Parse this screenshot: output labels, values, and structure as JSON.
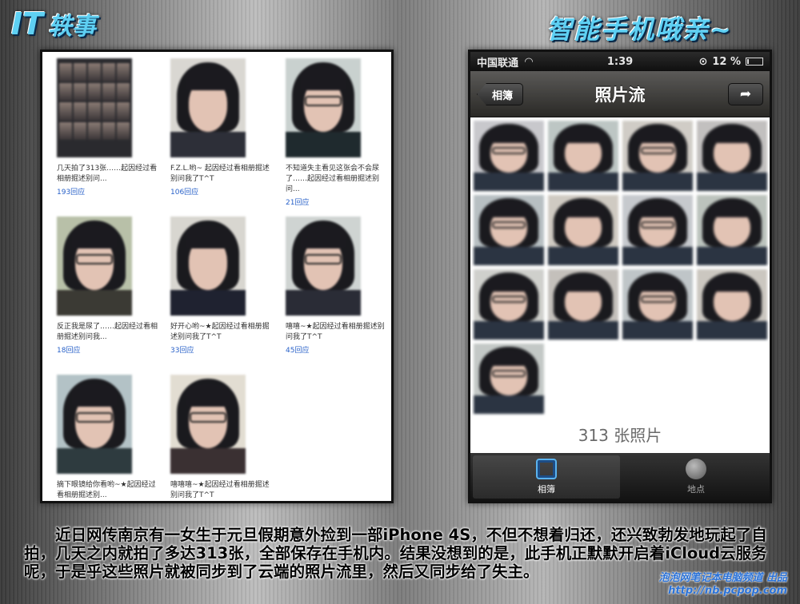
{
  "header": {
    "logo_it": "IT",
    "logo_cn": "轶事",
    "headline": "智能手机哦亲~"
  },
  "left_panel": {
    "items": [
      {
        "caption": "几天拍了313张……起因经过看相册掘述别问...",
        "replies": "193回应",
        "kind": "mosaic"
      },
      {
        "caption": "F.Z.L.哟~ 起因经过看相册掘述别问我了T^T",
        "replies": "106回应",
        "kind": "face"
      },
      {
        "caption": "不知道失主看见这张会不会尿了……起因经过看相册掘述别问...",
        "replies": "21回应",
        "kind": "face"
      },
      {
        "caption": "反正我是尿了……起因经过看相册掘述别问我...",
        "replies": "18回应",
        "kind": "face"
      },
      {
        "caption": "好开心哟~★起因经过看相册掘述别问我了T^T",
        "replies": "33回应",
        "kind": "face"
      },
      {
        "caption": "嘻嘻~★起因经过看相册掘述别问我了T^T",
        "replies": "45回应",
        "kind": "face"
      },
      {
        "caption": "摘下眼镜给你看哟~★起因经过看相册掘述别...",
        "replies": "",
        "kind": "face"
      },
      {
        "caption": "嘻嘻嘻~★起因经过看相册掘述别问我了T^T",
        "replies": "",
        "kind": "face"
      }
    ]
  },
  "phone": {
    "status": {
      "carrier": "中国联通",
      "time": "1:39",
      "battery": "12 %",
      "battery_level": 0.12
    },
    "nav": {
      "back_label": "相簿",
      "title": "照片流",
      "share_icon": "share-icon"
    },
    "thumb_count_visible": 13,
    "photo_count": "313 张照片",
    "tabs": [
      {
        "label": "相簿",
        "icon": "albums-icon",
        "active": true
      },
      {
        "label": "地点",
        "icon": "globe-icon",
        "active": false
      }
    ]
  },
  "footer": {
    "description": "近日网传南京有一女生于元旦假期意外捡到一部iPhone 4S，不但不想着归还，还兴致勃发地玩起了自拍，几天之内就拍了多达313张，全部保存在手机内。结果没想到的是，此手机正默默开启着iCloud云服务呢，于是乎这些照片就被同步到了云端的照片流里，然后又同步给了失主。",
    "credit_line1": "泡泡网笔记本电脑频道 出品",
    "credit_line2": "http://nb.pcpop.com"
  },
  "colors": {
    "accent": "#5ed0f3",
    "link_blue": "#2a62c9",
    "credit_blue": "#2a72d8"
  }
}
